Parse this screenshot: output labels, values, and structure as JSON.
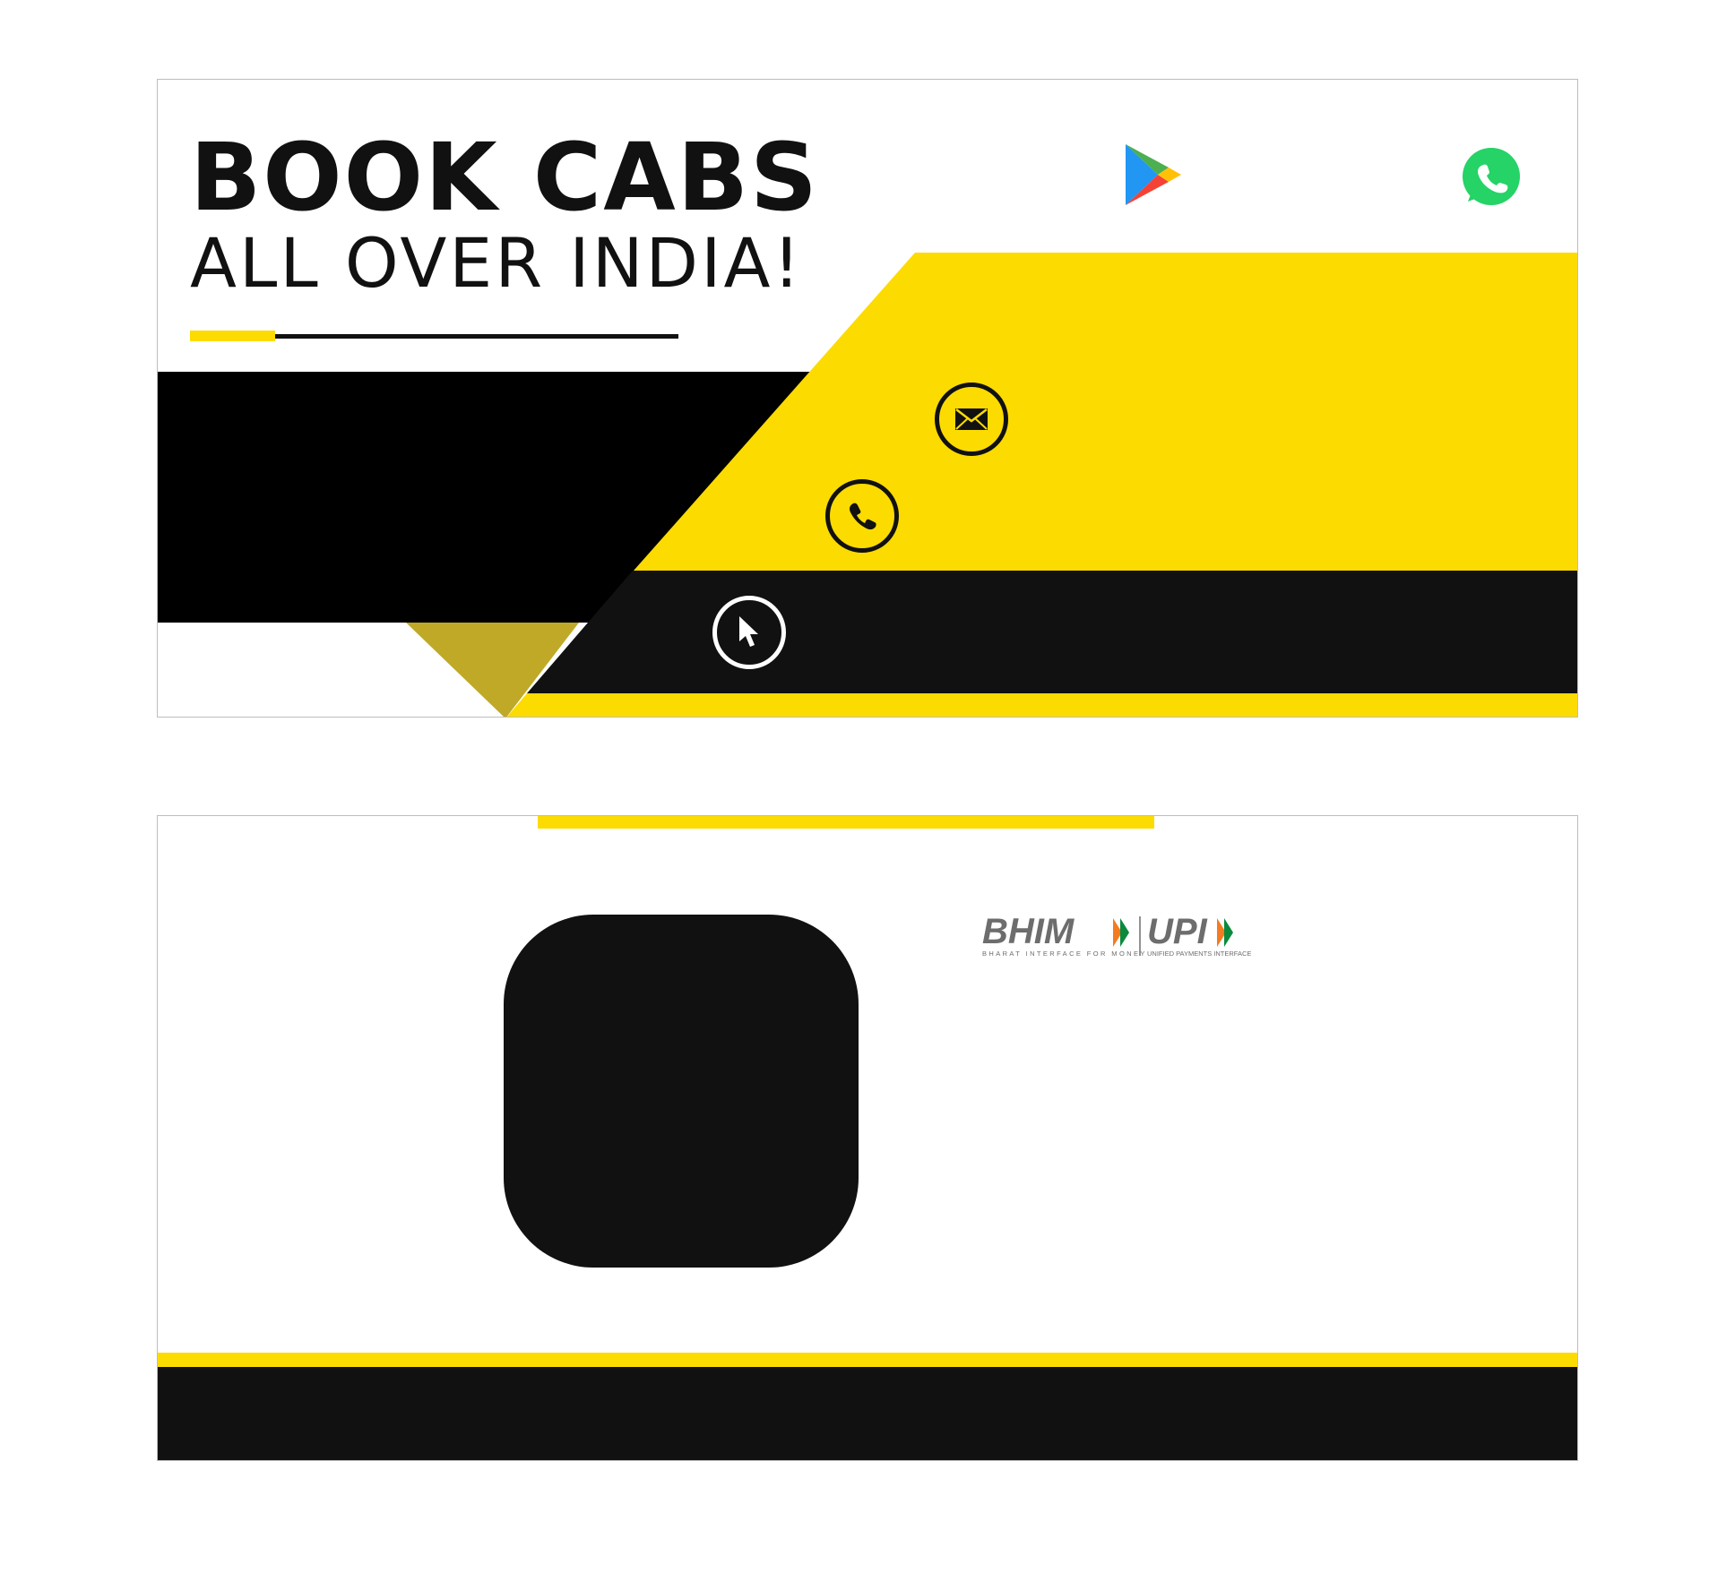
{
  "front_card": {
    "headline": "BOOK CABS",
    "subheadline": "ALL OVER INDIA!",
    "icons": {
      "play_store": "google-play-icon",
      "whatsapp": "whatsapp-icon",
      "email": "email-icon",
      "phone": "phone-icon",
      "website": "cursor-icon"
    }
  },
  "back_card": {
    "logo_text_bhim": "BHIM",
    "logo_sub_bhim": "BHARAT INTERFACE FOR MONEY",
    "logo_text_upi": "UPI",
    "logo_sub_upi": "UNIFIED PAYMENTS INTERFACE"
  },
  "colors": {
    "accent_yellow": "#FCDB00",
    "black": "#111111",
    "olive": "#BFA927",
    "whatsapp_green": "#25D366"
  }
}
